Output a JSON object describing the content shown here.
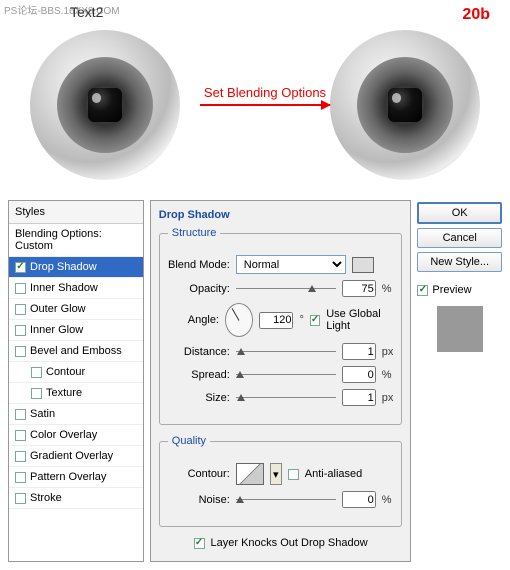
{
  "watermark": "PS论坛-BBS.16XX8.COM",
  "header": {
    "top_label": "Text2",
    "step": "20b",
    "arrow_text": "Set Blending Options"
  },
  "styles": {
    "header": "Styles",
    "blending": "Blending Options: Custom",
    "items": [
      {
        "label": "Drop Shadow",
        "checked": true,
        "selected": true
      },
      {
        "label": "Inner Shadow",
        "checked": false
      },
      {
        "label": "Outer Glow",
        "checked": false
      },
      {
        "label": "Inner Glow",
        "checked": false
      },
      {
        "label": "Bevel and Emboss",
        "checked": false
      },
      {
        "label": "Contour",
        "checked": false,
        "indent": true
      },
      {
        "label": "Texture",
        "checked": false,
        "indent": true
      },
      {
        "label": "Satin",
        "checked": false
      },
      {
        "label": "Color Overlay",
        "checked": false
      },
      {
        "label": "Gradient Overlay",
        "checked": false
      },
      {
        "label": "Pattern Overlay",
        "checked": false
      },
      {
        "label": "Stroke",
        "checked": false
      }
    ]
  },
  "main": {
    "title": "Drop Shadow",
    "structure": {
      "legend": "Structure",
      "blend_mode_label": "Blend Mode:",
      "blend_mode": "Normal",
      "opacity_label": "Opacity:",
      "opacity": "75",
      "opacity_unit": "%",
      "angle_label": "Angle:",
      "angle": "120",
      "angle_unit": "°",
      "global_light_label": "Use Global Light",
      "global_light": true,
      "distance_label": "Distance:",
      "distance": "1",
      "distance_unit": "px",
      "spread_label": "Spread:",
      "spread": "0",
      "spread_unit": "%",
      "size_label": "Size:",
      "size": "1",
      "size_unit": "px"
    },
    "quality": {
      "legend": "Quality",
      "contour_label": "Contour:",
      "anti_label": "Anti-aliased",
      "anti": false,
      "noise_label": "Noise:",
      "noise": "0",
      "noise_unit": "%"
    },
    "knockout_label": "Layer Knocks Out Drop Shadow",
    "knockout": true
  },
  "buttons": {
    "ok": "OK",
    "cancel": "Cancel",
    "new_style": "New Style...",
    "preview": "Preview"
  }
}
